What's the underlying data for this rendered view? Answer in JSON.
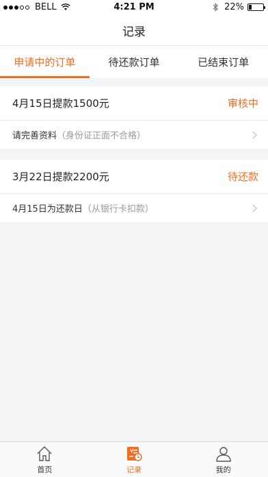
{
  "status_bar": {
    "carrier": "BELL",
    "time": "4:21 PM",
    "battery_percent": "22%",
    "battery_level": 0.22
  },
  "nav": {
    "title": "记录"
  },
  "tabs": [
    {
      "label": "申请中的订单",
      "active": true
    },
    {
      "label": "待还款订单",
      "active": false
    },
    {
      "label": "已结束订单",
      "active": false
    }
  ],
  "orders": [
    {
      "title": "4月15日提款1500元",
      "status": "审核中",
      "detail": "请完善资料",
      "note": "（身份证正面不合格）"
    },
    {
      "title": "3月22日提款2200元",
      "status": "待还款",
      "detail": "4月15日为还款日",
      "note": "（从银行卡扣款）"
    }
  ],
  "tab_bar": [
    {
      "label": "首页",
      "icon": "home-icon"
    },
    {
      "label": "记录",
      "icon": "record-icon"
    },
    {
      "label": "我的",
      "icon": "user-icon"
    }
  ],
  "colors": {
    "accent": "#f36c21"
  }
}
